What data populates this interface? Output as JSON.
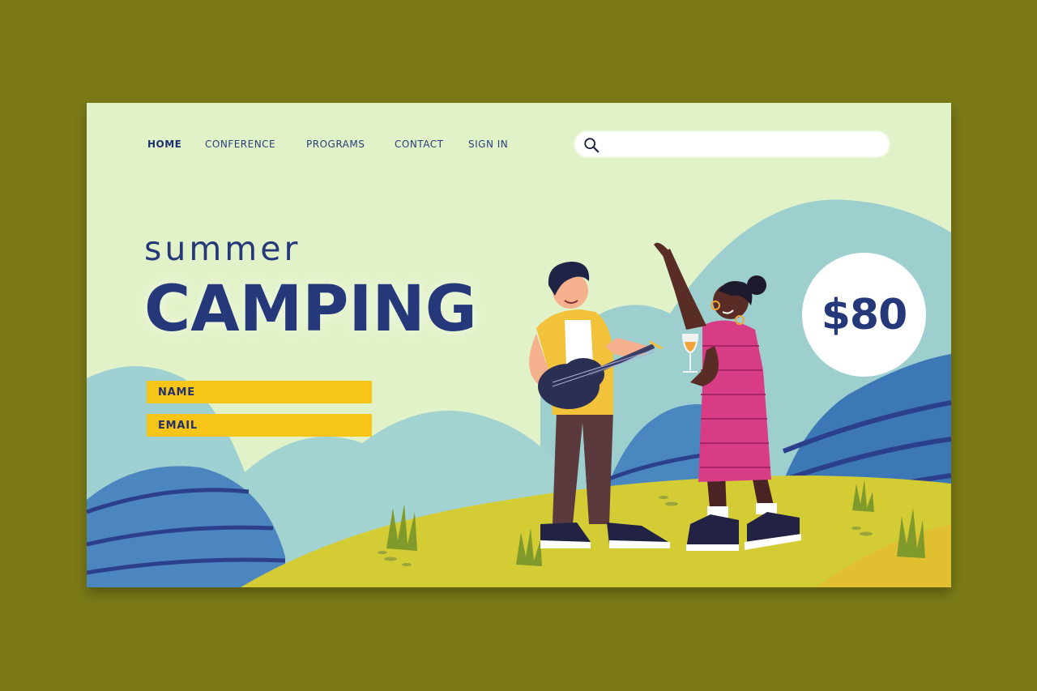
{
  "nav": {
    "items": [
      {
        "label": "HOME",
        "active": true
      },
      {
        "label": "CONFERENCE",
        "active": false
      },
      {
        "label": "PROGRAMS",
        "active": false
      },
      {
        "label": "CONTACT",
        "active": false
      },
      {
        "label": "SIGN IN",
        "active": false
      }
    ]
  },
  "search": {
    "icon": "search-icon",
    "value": ""
  },
  "hero": {
    "subtitle": "summer",
    "title": "CAMPING"
  },
  "form": {
    "name_label": "NAME",
    "email_label": "EMAIL"
  },
  "price": {
    "label": "$80"
  },
  "colors": {
    "background": "#7b7a17",
    "card": "#e2f2c8",
    "brand_navy": "#24387a",
    "accent_yellow": "#f7c518",
    "dress_pink": "#d83c85"
  }
}
